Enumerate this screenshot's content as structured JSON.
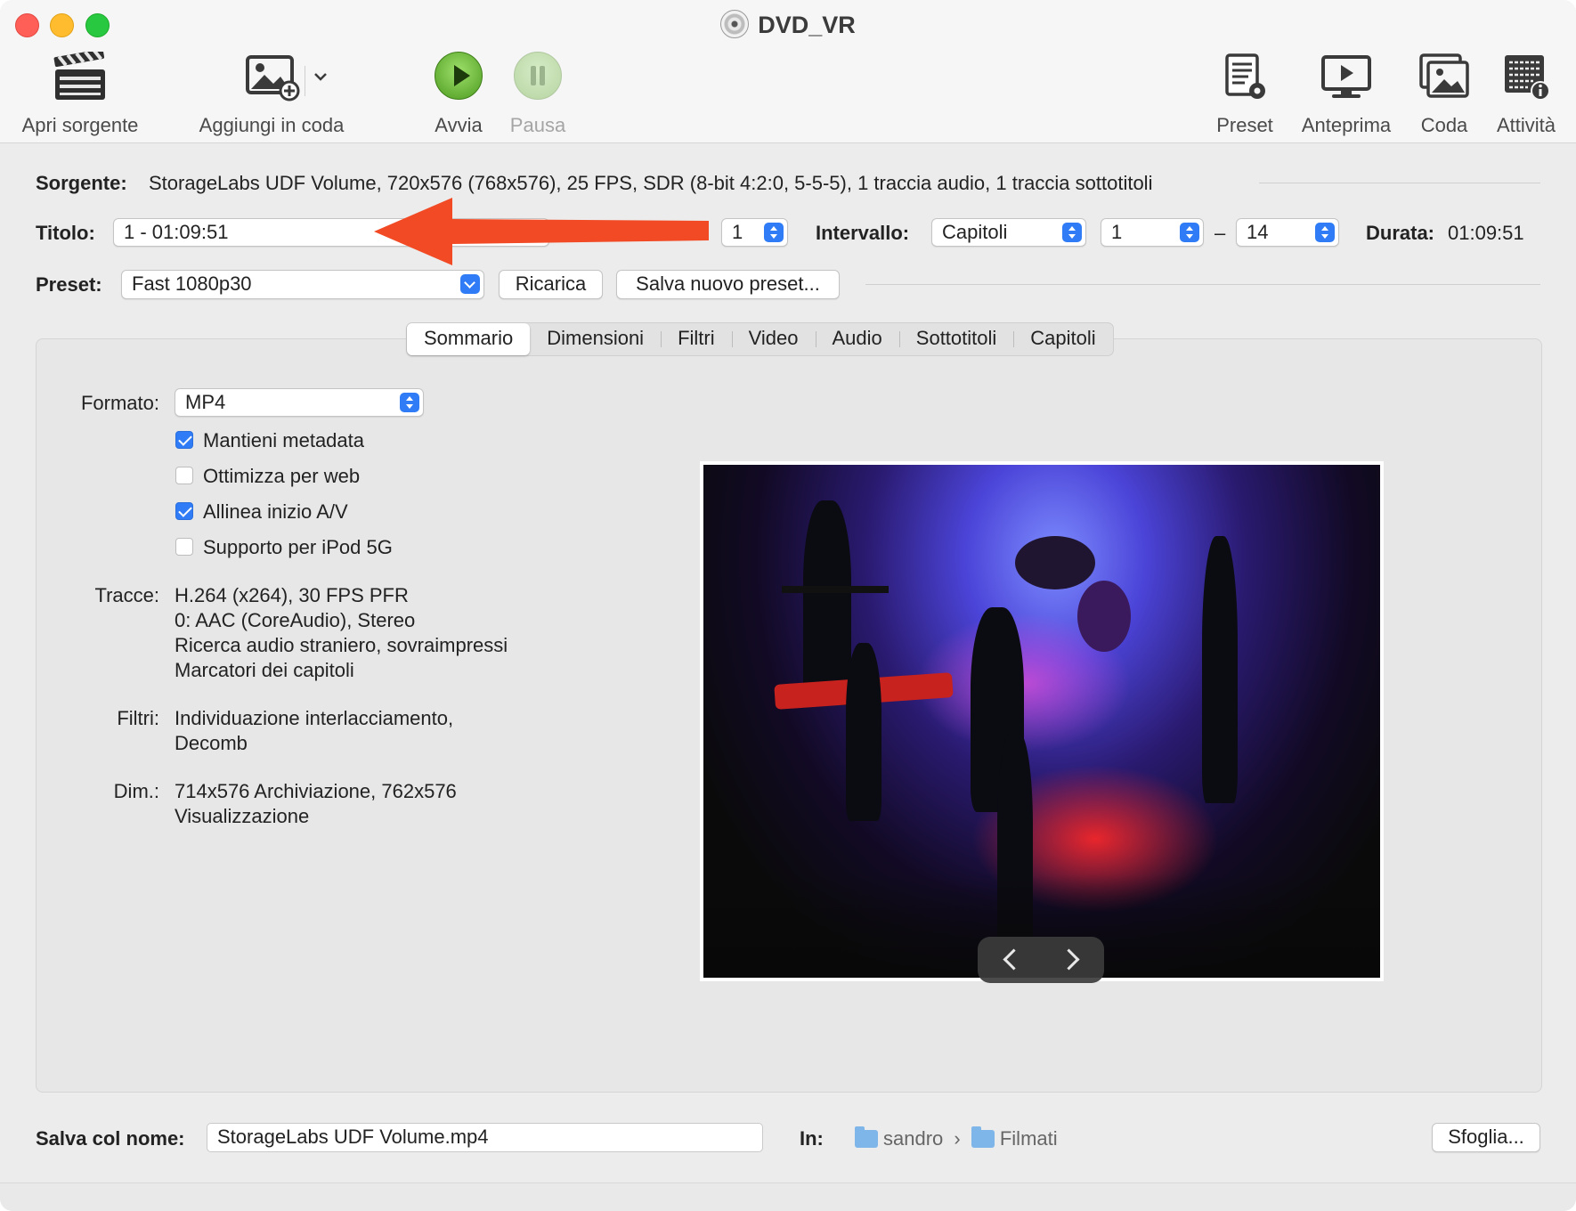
{
  "window": {
    "title": "DVD_VR"
  },
  "toolbar": {
    "open_source": "Apri sorgente",
    "add_to_queue": "Aggiungi in coda",
    "start": "Avvia",
    "pause": "Pausa",
    "presets": "Preset",
    "preview": "Anteprima",
    "queue": "Coda",
    "activity": "Attività"
  },
  "source": {
    "label": "Sorgente:",
    "value": "StorageLabs UDF Volume, 720x576 (768x576), 25 FPS, SDR (8-bit 4:2:0, 5-5-5), 1 traccia audio, 1 traccia sottotitoli"
  },
  "title_row": {
    "label": "Titolo:",
    "title_value": "1 - 01:09:51",
    "angle_value": "1",
    "range_label": "Intervallo:",
    "range_type": "Capitoli",
    "range_start": "1",
    "range_dash": "–",
    "range_end": "14",
    "duration_label": "Durata:",
    "duration_value": "01:09:51"
  },
  "preset_row": {
    "label": "Preset:",
    "value": "Fast 1080p30",
    "reload": "Ricarica",
    "save_new": "Salva nuovo preset..."
  },
  "tabs": [
    "Sommario",
    "Dimensioni",
    "Filtri",
    "Video",
    "Audio",
    "Sottotitoli",
    "Capitoli"
  ],
  "summary": {
    "format_label": "Formato:",
    "format_value": "MP4",
    "checkboxes": [
      {
        "label": "Mantieni metadata",
        "checked": true
      },
      {
        "label": "Ottimizza per web",
        "checked": false
      },
      {
        "label": "Allinea inizio A/V",
        "checked": true
      },
      {
        "label": "Supporto per iPod 5G",
        "checked": false
      }
    ],
    "tracks_label": "Tracce:",
    "tracks": [
      "H.264 (x264), 30 FPS PFR",
      "0: AAC (CoreAudio), Stereo",
      "Ricerca audio straniero, sovraimpressi",
      "Marcatori dei capitoli"
    ],
    "filters_label": "Filtri:",
    "filters": [
      "Individuazione interlacciamento,",
      "Decomb"
    ],
    "dims_label": "Dim.:",
    "dims": [
      "714x576 Archiviazione, 762x576",
      "Visualizzazione"
    ]
  },
  "save": {
    "label": "Salva col nome:",
    "filename": "StorageLabs UDF Volume.mp4",
    "in_label": "In:",
    "path_home": "sandro",
    "path_sep": "›",
    "path_folder": "Filmati",
    "browse": "Sfoglia..."
  },
  "colors": {
    "accent": "#2f7cf6",
    "annotation_arrow": "#f14a24",
    "play_green": "#4c9a1f"
  }
}
